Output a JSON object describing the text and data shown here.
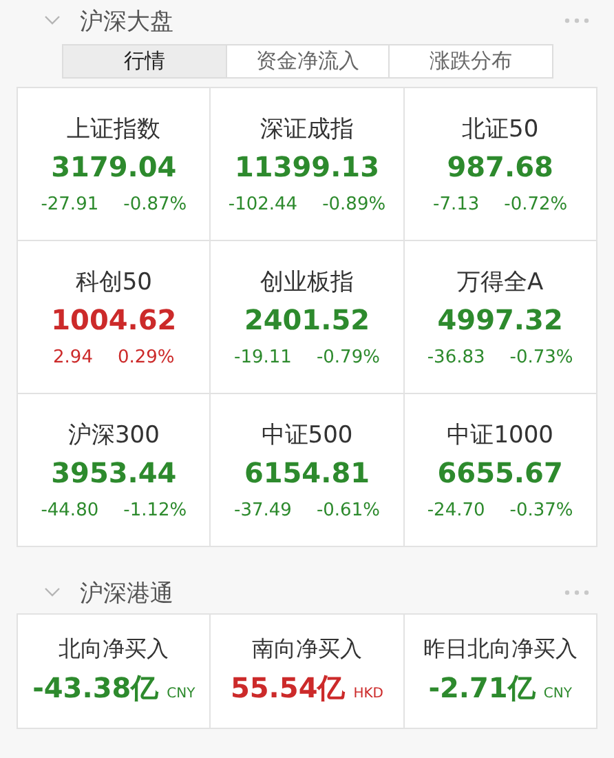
{
  "sections": [
    {
      "title": "沪深大盘",
      "expanded": true,
      "tabs": [
        {
          "label": "行情",
          "selected": true
        },
        {
          "label": "资金净流入",
          "selected": false
        },
        {
          "label": "涨跌分布",
          "selected": false
        }
      ],
      "indices": [
        {
          "name": "上证指数",
          "value": "3179.04",
          "change": "-27.91",
          "percent": "-0.87%",
          "color": "#2d8a2d"
        },
        {
          "name": "深证成指",
          "value": "11399.13",
          "change": "-102.44",
          "percent": "-0.89%",
          "color": "#2d8a2d"
        },
        {
          "name": "北证50",
          "value": "987.68",
          "change": "-7.13",
          "percent": "-0.72%",
          "color": "#2d8a2d"
        },
        {
          "name": "科创50",
          "value": "1004.62",
          "change": "2.94",
          "percent": "0.29%",
          "color": "#cc2a2a"
        },
        {
          "name": "创业板指",
          "value": "2401.52",
          "change": "-19.11",
          "percent": "-0.79%",
          "color": "#2d8a2d"
        },
        {
          "name": "万得全A",
          "value": "4997.32",
          "change": "-36.83",
          "percent": "-0.73%",
          "color": "#2d8a2d"
        },
        {
          "name": "沪深300",
          "value": "3953.44",
          "change": "-44.80",
          "percent": "-1.12%",
          "color": "#2d8a2d"
        },
        {
          "name": "中证500",
          "value": "6154.81",
          "change": "-37.49",
          "percent": "-0.61%",
          "color": "#2d8a2d"
        },
        {
          "name": "中证1000",
          "value": "6655.67",
          "change": "-24.70",
          "percent": "-0.37%",
          "color": "#2d8a2d"
        }
      ]
    },
    {
      "title": "沪深港通",
      "expanded": true,
      "flows": [
        {
          "name": "北向净买入",
          "value": "-43.38亿",
          "currency": "CNY",
          "color": "#2d8a2d"
        },
        {
          "name": "南向净买入",
          "value": "55.54亿",
          "currency": "HKD",
          "color": "#cc2a2a"
        },
        {
          "name": "昨日北向净买入",
          "value": "-2.71亿",
          "currency": "CNY",
          "color": "#2d8a2d"
        }
      ]
    }
  ]
}
